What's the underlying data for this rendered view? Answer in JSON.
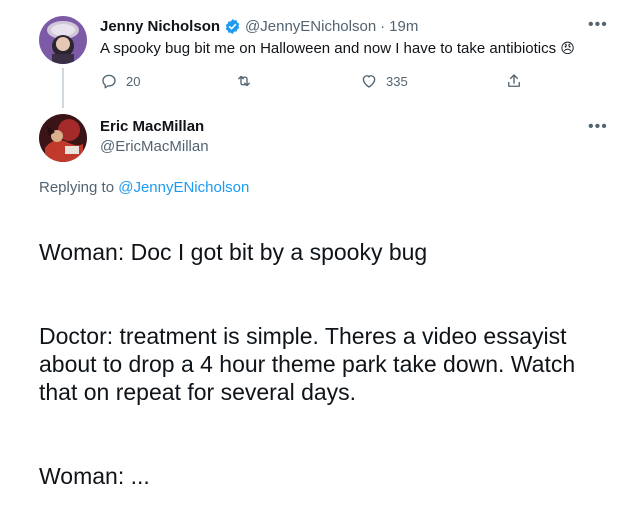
{
  "parent_tweet": {
    "display_name": "Jenny Nicholson",
    "handle": "@JennyENicholson",
    "separator": "·",
    "time": "19m",
    "text": "A spooky bug bit me on Halloween and now I have to take antibiotics",
    "emoji": "😠",
    "actions": {
      "reply_count": "20",
      "retweet_count": "",
      "like_count": "335"
    },
    "icons": [
      "verified-badge-icon",
      "reply-icon",
      "retweet-icon",
      "like-icon",
      "share-icon",
      "more-icon"
    ]
  },
  "reply_tweet": {
    "display_name": "Eric MacMillan",
    "handle": "@EricMacMillan",
    "replying_prefix": "Replying to",
    "replying_to": "@JennyENicholson",
    "body_lines": [
      "Woman: Doc I got bit by a spooky bug",
      "Doctor: treatment is simple. Theres a video essayist about to drop a 4 hour theme park take down. Watch that on repeat for several days.",
      "Woman: ..."
    ]
  },
  "colors": {
    "accent": "#1d9bf0",
    "text": "#0f1419",
    "muted": "#536471",
    "thread_line": "#cfd9de"
  }
}
